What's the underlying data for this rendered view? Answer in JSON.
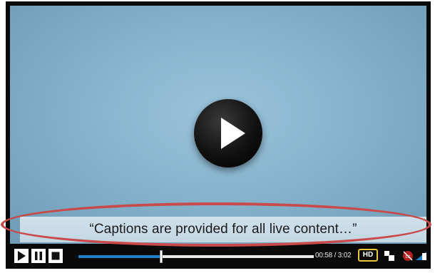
{
  "player": {
    "caption": "“Captions are provided for all live content…”",
    "time": {
      "current": "00:58",
      "separator": " / ",
      "duration": "3:02"
    },
    "progress_fraction": 0.35,
    "hd_label": "HD",
    "icons": {
      "big_play": "play-icon",
      "play": "play-icon",
      "pause": "pause-icon",
      "stop": "stop-icon",
      "settings": "settings-icon",
      "captions": "captions-off-icon",
      "volume": "volume-icon"
    },
    "colors": {
      "highlight": "#c94a4a",
      "seek_fill": "#1f7fc9",
      "hd_border": "#e7c83a",
      "video_bg": "#86b3cc"
    }
  }
}
